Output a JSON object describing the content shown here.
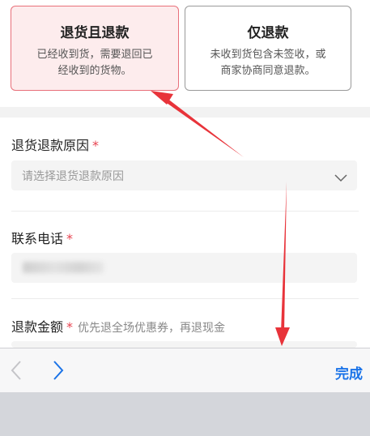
{
  "refund_options": [
    {
      "title": "退货且退款",
      "desc_line1": "已经收到货，需要退回已",
      "desc_line2": "经收到的货物。",
      "selected": true
    },
    {
      "title": "仅退款",
      "desc_line1": "未收到货包含未签收，或",
      "desc_line2": "商家协商同意退款。",
      "selected": false
    }
  ],
  "form": {
    "reason": {
      "label": "退货退款原因",
      "required_mark": "*",
      "placeholder": "请选择退货退款原因"
    },
    "phone": {
      "label": "联系电话",
      "required_mark": "*"
    },
    "amount": {
      "label": "退款金额",
      "required_mark": "*",
      "hint": "优先退全场优惠券，再退现金"
    }
  },
  "toolbar": {
    "done_label": "完成"
  },
  "colors": {
    "accent": "#1a73e8",
    "required": "#e8434f",
    "selected_border": "#e8707a",
    "annotation_arrow": "#e8333a"
  },
  "icons": [
    "chevron-left-icon",
    "chevron-right-icon",
    "chevron-down-icon"
  ]
}
